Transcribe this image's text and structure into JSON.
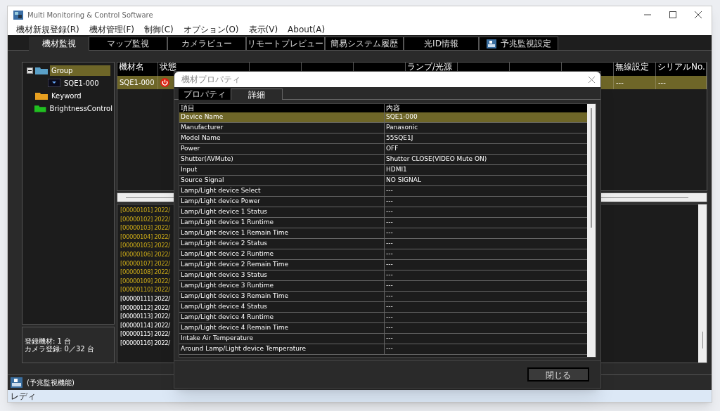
{
  "window": {
    "title": "Multi Monitoring & Control Software"
  },
  "menu": [
    "機材新規登録(R)",
    "機材管理(F)",
    "制御(C)",
    "オプション(O)",
    "表示(V)",
    "About(A)"
  ],
  "tabs": [
    {
      "label": "機材監視",
      "selected": true,
      "icon": false
    },
    {
      "label": "マップ監視",
      "selected": false,
      "icon": false
    },
    {
      "label": "カメラビュー",
      "selected": false,
      "icon": false
    },
    {
      "label": "リモートプレビュー",
      "selected": false,
      "icon": false
    },
    {
      "label": "簡易システム履歴",
      "selected": false,
      "icon": false
    },
    {
      "label": "光ID情報",
      "selected": false,
      "icon": false
    },
    {
      "label": "予兆監視設定",
      "selected": false,
      "icon": true
    }
  ],
  "tree": [
    {
      "label": "Group",
      "kind": "group",
      "selected": true,
      "expanded": true,
      "children": [
        {
          "label": "SQE1-000",
          "kind": "device",
          "selected": false
        }
      ]
    },
    {
      "label": "Keyword",
      "kind": "keyword",
      "selected": false
    },
    {
      "label": "BrightnessControl",
      "kind": "brightness",
      "selected": false
    }
  ],
  "counts": [
    "登録機材: 1 台",
    "カメラ登録: 0／32 台"
  ],
  "device_table": {
    "columns": [
      "機材名",
      "状態",
      "",
      "",
      "",
      "ランプ/光源",
      "",
      "",
      "",
      "無線設定",
      "シリアルNo."
    ],
    "rows": [
      {
        "selected": true,
        "cells": [
          "SQE1-000",
          "",
          "",
          "",
          "",
          "",
          "",
          "",
          "",
          "---",
          "---"
        ],
        "power_off": true
      }
    ]
  },
  "log": [
    {
      "text": "[00000101] 2022/",
      "highlighted": true
    },
    {
      "text": "[00000102] 2022/",
      "highlighted": true
    },
    {
      "text": "[00000103] 2022/",
      "highlighted": true
    },
    {
      "text": "[00000104] 2022/",
      "highlighted": true
    },
    {
      "text": "[00000105] 2022/",
      "highlighted": true
    },
    {
      "text": "[00000106] 2022/",
      "highlighted": true
    },
    {
      "text": "[00000107] 2022/",
      "highlighted": true
    },
    {
      "text": "[00000108] 2022/",
      "highlighted": true
    },
    {
      "text": "[00000109] 2022/",
      "highlighted": true
    },
    {
      "text": "[00000110] 2022/",
      "highlighted": true
    },
    {
      "text": "[00000111] 2022/",
      "highlighted": false
    },
    {
      "text": "[00000112] 2022/",
      "highlighted": false
    },
    {
      "text": "[00000113] 2022/",
      "highlighted": false
    },
    {
      "text": "[00000114] 2022/",
      "highlighted": false
    },
    {
      "text": "[00000115] 2022/",
      "highlighted": false
    },
    {
      "text": "[00000116] 2022/",
      "highlighted": false
    }
  ],
  "bottom_bar": {
    "label": "(予兆監視機能)"
  },
  "status_bar": "レディ",
  "dialog": {
    "title": "機材プロパティ",
    "tabs": [
      {
        "label": "プロパティ",
        "selected": false
      },
      {
        "label": "詳細",
        "selected": true
      }
    ],
    "columns": [
      "項目",
      "内容"
    ],
    "rows": [
      {
        "item": "Device Name",
        "value": "SQE1-000",
        "selected": true
      },
      {
        "item": "Manufacturer",
        "value": "Panasonic",
        "selected": false
      },
      {
        "item": "Model Name",
        "value": "55SQE1J",
        "selected": false
      },
      {
        "item": "Power",
        "value": "OFF",
        "selected": false
      },
      {
        "item": "Shutter(AVMute)",
        "value": "Shutter CLOSE(VIDEO Mute ON)",
        "selected": false
      },
      {
        "item": "Input",
        "value": "HDMI1",
        "selected": false
      },
      {
        "item": "Source Signal",
        "value": "NO SIGNAL",
        "selected": false
      },
      {
        "item": "Lamp/Light device Select",
        "value": "---",
        "selected": false
      },
      {
        "item": "Lamp/Light device Power",
        "value": "---",
        "selected": false
      },
      {
        "item": "Lamp/Light device 1 Status",
        "value": "---",
        "selected": false
      },
      {
        "item": "Lamp/Light device 1 Runtime",
        "value": "---",
        "selected": false
      },
      {
        "item": "Lamp/Light device 1 Remain Time",
        "value": "---",
        "selected": false
      },
      {
        "item": "Lamp/Light device 2 Status",
        "value": "---",
        "selected": false
      },
      {
        "item": "Lamp/Light device 2 Runtime",
        "value": "---",
        "selected": false
      },
      {
        "item": "Lamp/Light device 2 Remain Time",
        "value": "---",
        "selected": false
      },
      {
        "item": "Lamp/Light device 3 Status",
        "value": "---",
        "selected": false
      },
      {
        "item": "Lamp/Light device 3 Runtime",
        "value": "---",
        "selected": false
      },
      {
        "item": "Lamp/Light device 3 Remain Time",
        "value": "---",
        "selected": false
      },
      {
        "item": "Lamp/Light device 4 Status",
        "value": "---",
        "selected": false
      },
      {
        "item": "Lamp/Light device 4 Runtime",
        "value": "---",
        "selected": false
      },
      {
        "item": "Lamp/Light device 4 Remain Time",
        "value": "---",
        "selected": false
      },
      {
        "item": "Intake Air Temperature",
        "value": "---",
        "selected": false
      },
      {
        "item": "Around Lamp/Light device Temperature",
        "value": "---",
        "selected": false
      }
    ],
    "close_button": "閉じる"
  }
}
